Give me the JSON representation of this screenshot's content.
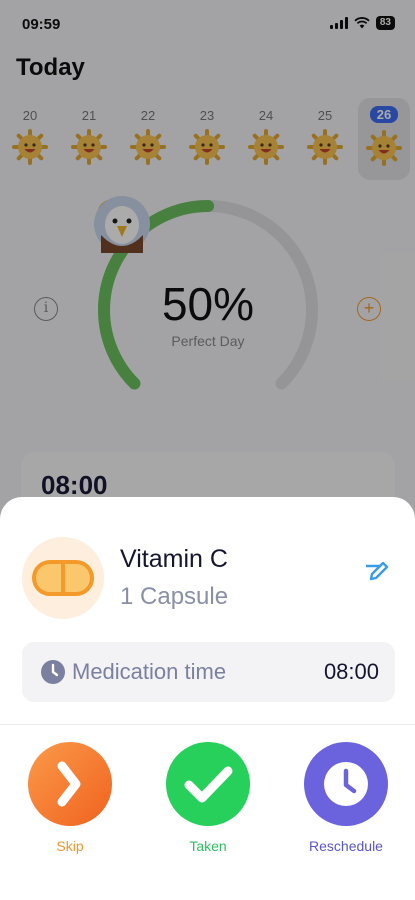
{
  "status_bar": {
    "time": "09:59",
    "battery": "83"
  },
  "page": {
    "title": "Today"
  },
  "date_strip": {
    "days": [
      {
        "day": "20"
      },
      {
        "day": "21"
      },
      {
        "day": "22"
      },
      {
        "day": "23"
      },
      {
        "day": "24"
      },
      {
        "day": "25"
      },
      {
        "day": "26",
        "selected": true
      }
    ]
  },
  "progress": {
    "percent_label": "50%",
    "subtitle": "Perfect Day",
    "fraction": 0.5
  },
  "schedule_card": {
    "time": "08:00"
  },
  "medication": {
    "name": "Vitamin C",
    "dose": "1 Capsule",
    "time_label": "Medication time",
    "time_value": "08:00"
  },
  "actions": {
    "skip_label": "Skip",
    "taken_label": "Taken",
    "reschedule_label": "Reschedule"
  },
  "colors": {
    "ring_progress": "#6cc05f",
    "ring_track": "#dedee3",
    "skip": "#f2962f",
    "taken": "#27d05a",
    "reschedule": "#6a63dd",
    "accent_date": "#3d6cf2"
  }
}
